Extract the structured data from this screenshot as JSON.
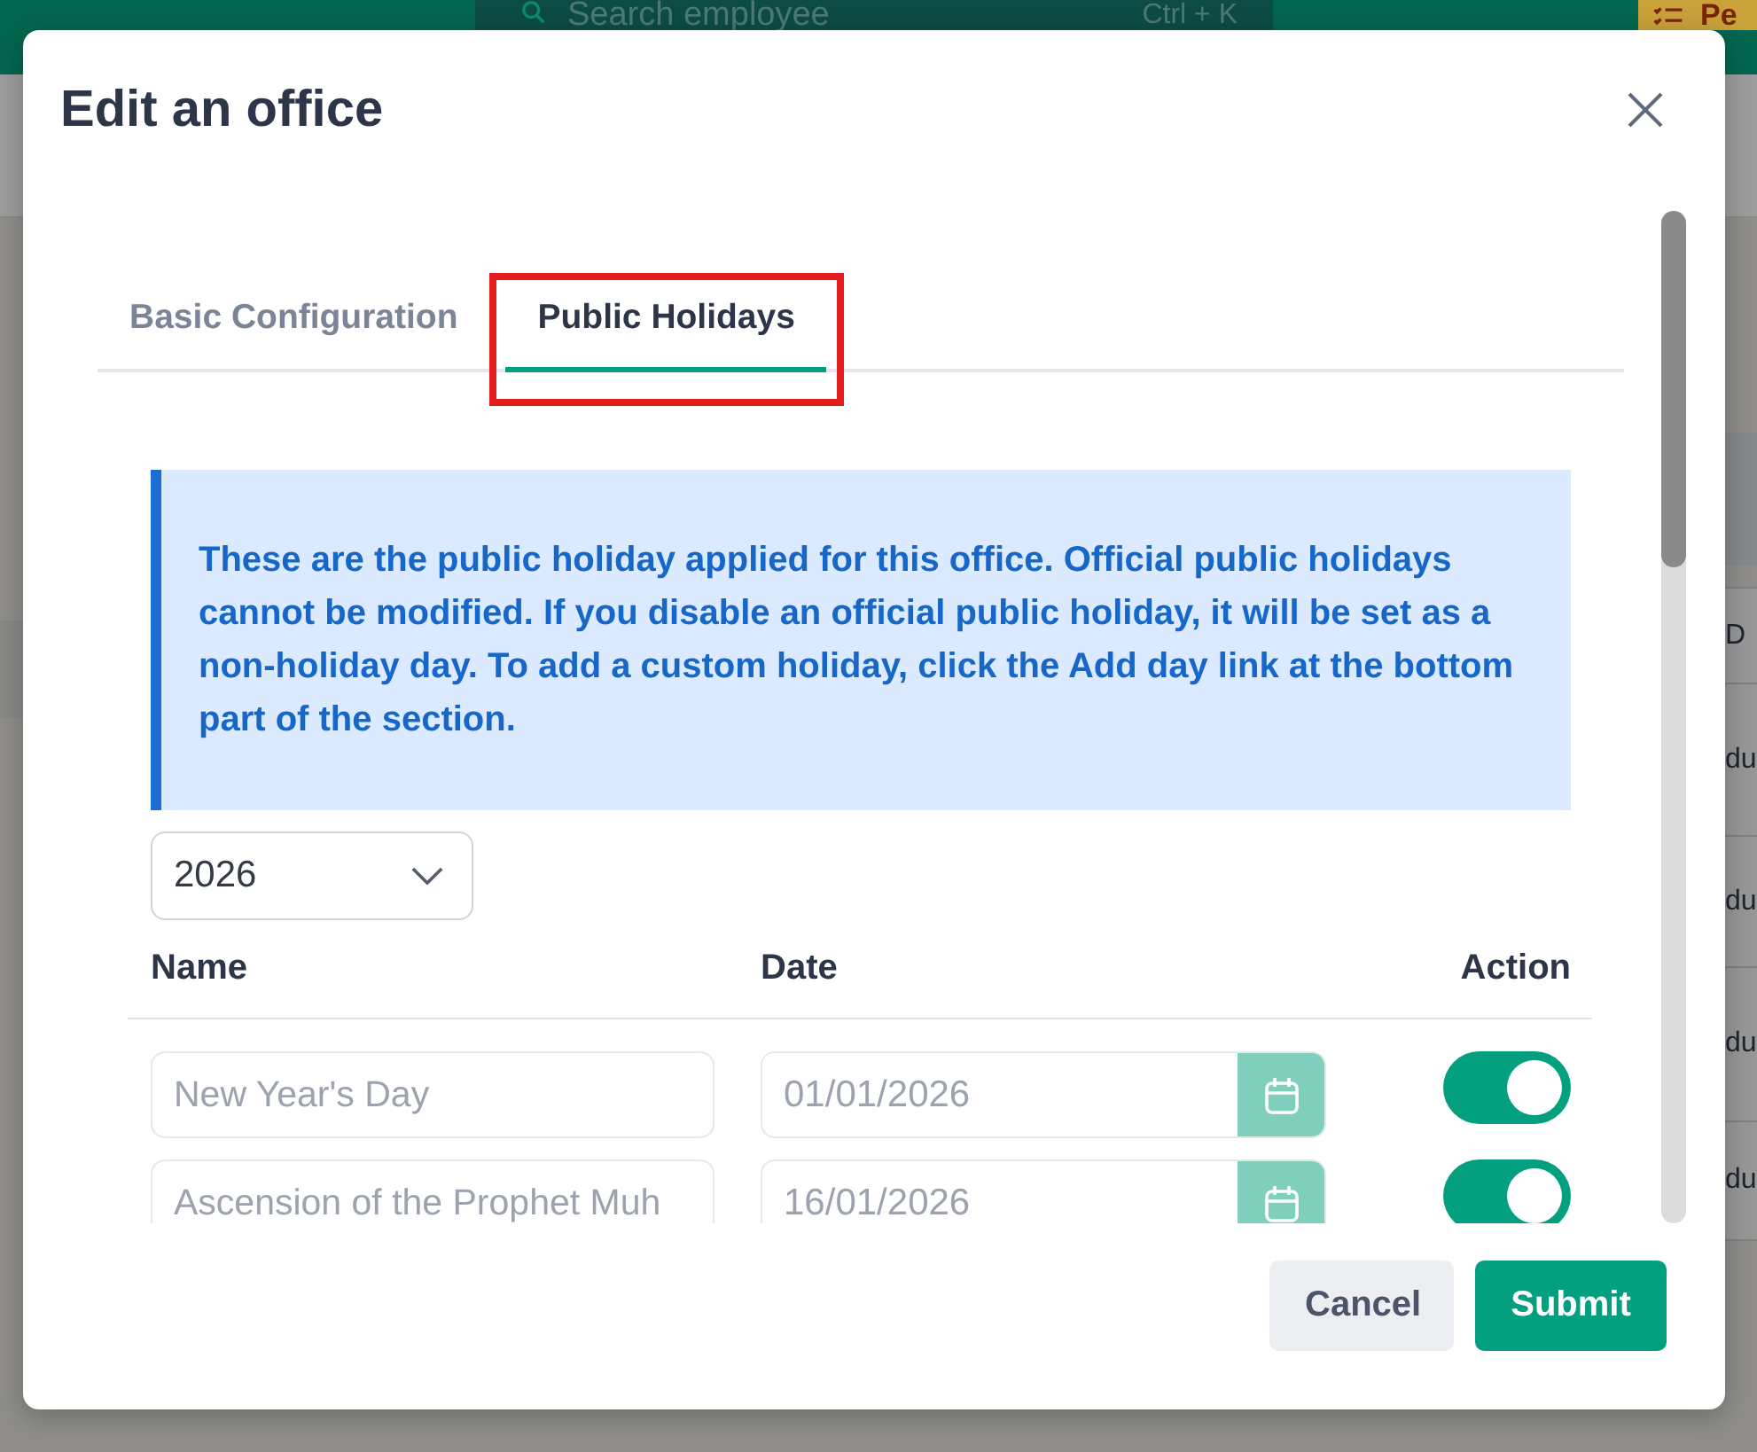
{
  "header": {
    "search": {
      "placeholder": "Search employee",
      "shortcut": "Ctrl + K"
    },
    "action_button": {
      "label": "Pe"
    }
  },
  "background_table": {
    "column_header": "D",
    "cells": [
      "du",
      "du",
      "du",
      "du"
    ]
  },
  "dialog": {
    "title": "Edit an office",
    "tabs": [
      {
        "label": "Basic Configuration",
        "selected": false,
        "highlighted": false
      },
      {
        "label": "Public Holidays",
        "selected": true,
        "highlighted": true
      }
    ],
    "notice": "These are the public holiday applied for this office. Official public holidays cannot be modified. If you disable an official public holiday, it will be set as a non-holiday day. To add a custom holiday, click the Add day link at the bottom part of the section.",
    "year_select": {
      "value": "2026"
    },
    "table": {
      "columns": [
        "Name",
        "Date",
        "Action"
      ],
      "rows": [
        {
          "name": "New Year's Day",
          "date": "01/01/2026",
          "on": true
        },
        {
          "name": "Ascension of the Prophet Muh",
          "date": "16/01/2026",
          "on": true
        }
      ]
    },
    "buttons": [
      {
        "label": "Cancel",
        "kind": "secondary"
      },
      {
        "label": "Submit",
        "kind": "primary"
      }
    ]
  }
}
